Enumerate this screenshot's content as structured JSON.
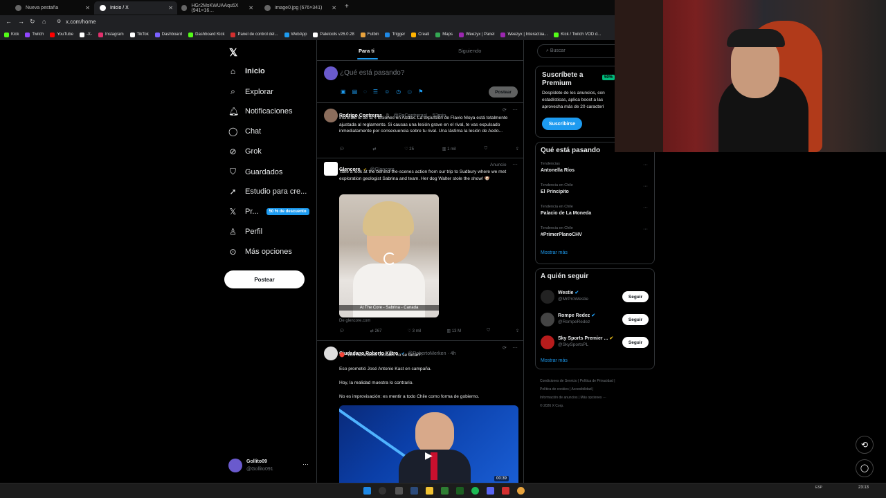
{
  "browser": {
    "tabs": [
      {
        "title": "Nueva pestaña",
        "active": false
      },
      {
        "title": "Inicio / X",
        "active": true
      },
      {
        "title": "HGr2MsKWUAAqu5X (941×16…",
        "active": false
      },
      {
        "title": "image0.jpg (676×341)",
        "active": false
      }
    ],
    "url": "x.com/home",
    "bookmarks": [
      "Kick",
      "Twitch",
      "YouTube",
      "-X-",
      "Instagram",
      "TikTok",
      "Dashboard",
      "Dashboard Kick",
      "Panel de control del...",
      "WebApp",
      "Paletools v26.0.28",
      "Futbin",
      "Trigger",
      "Creati",
      "Maps",
      "Weezyx | Panel",
      "Weezyx | Interactúa...",
      "Kick / Twitch VOD d..."
    ]
  },
  "sidebar": {
    "items": [
      {
        "label": "Inicio",
        "icon": "home-icon"
      },
      {
        "label": "Explorar",
        "icon": "search-icon"
      },
      {
        "label": "Notificaciones",
        "icon": "bell-icon"
      },
      {
        "label": "Chat",
        "icon": "chat-icon"
      },
      {
        "label": "Grok",
        "icon": "grok-icon"
      },
      {
        "label": "Guardados",
        "icon": "bookmark-icon"
      },
      {
        "label": "Estudio para cre...",
        "icon": "rocket-icon"
      },
      {
        "label": "Pr...",
        "icon": "x-logo-icon"
      },
      {
        "label": "Perfil",
        "icon": "person-icon"
      },
      {
        "label": "Más opciones",
        "icon": "more-icon"
      }
    ],
    "promo_badge": "50 % de descuento",
    "post_button": "Postear",
    "account": {
      "name": "Gollito09",
      "handle": "@Gollito091"
    }
  },
  "feed": {
    "tabs": [
      "Para ti",
      "Siguiendo"
    ],
    "composer_placeholder": "¿Qué está pasando?",
    "composer_button": "Postear",
    "tweets": [
      {
        "name": "Rodrigo Contreras",
        "handle": "@RoContrerasL · 53min",
        "text": "Increíble lo de la 4 lesiones en Audax. La expulsión de Flavio Moya está totalmente ajustada al reglamento. Si causas una lesión grave en el rival, te vas expulsado inmediatamente por consecuencia sobre tu rival. Una lástima la lesión de Aedo...",
        "likes": "25",
        "views": "1 mil"
      },
      {
        "name": "Glencore",
        "handle": "@Glencore",
        "ad_label": "Anuncio",
        "text": "Take a look at the behind-the-scenes action from our trip to Sudbury where we met exploration geologist Sabrina and team. Her dog Walter stole the show! 🐶",
        "media_caption": "At The Core - Sabrina - Canada",
        "source": "De glencore.com",
        "retweets": "267",
        "likes": "3 mil",
        "views": "13 M"
      },
      {
        "name": "Ciudadano Roberto Kiltro",
        "handle": "@RobertoMerken · 4h",
        "lines": [
          "🔴 \"Los beneficios sociales no se tocan\".",
          "Eso prometió José Antonio Kast en campaña.",
          "Hoy, la realidad muestra lo contrario.",
          "No es improvisación: es mentir a todo Chile como forma de gobierno."
        ],
        "video_time": "00:39"
      }
    ]
  },
  "right": {
    "search_placeholder": "Buscar",
    "premium": {
      "title": "Suscríbete a Premium",
      "badge": "50%",
      "text": "Despídete de los anuncios, con estadísticas, aplica boost a las aprovecha más de 20 caracterí",
      "button": "Suscribirse"
    },
    "trends_title": "Qué está pasando",
    "trends": [
      {
        "context": "Tendencias",
        "name": "Antonella Ríos"
      },
      {
        "context": "Tendencia en Chile",
        "name": "El Principito"
      },
      {
        "context": "Tendencia en Chile",
        "name": "Palacio de La Moneda"
      },
      {
        "context": "Tendencia en Chile",
        "name": "#PrimerPlanoCHV"
      }
    ],
    "show_more": "Mostrar más",
    "follow_title": "A quién seguir",
    "follow": [
      {
        "name": "Westie",
        "handle": "@MrProWestie",
        "button": "Seguir"
      },
      {
        "name": "Rompe Redez",
        "handle": "@RompeRedez",
        "button": "Seguir"
      },
      {
        "name": "Sky Sports Premier ...",
        "handle": "@SkySportsPL",
        "button": "Seguir"
      }
    ],
    "footer": [
      "Condiciones de Servicio | Política de Privacidad |",
      "Política de cookies | Accesibilidad |",
      "Información de anuncios | Más opciones ···",
      "© 2026 X Corp."
    ]
  },
  "taskbar": {
    "lang": "ESP",
    "time": "23:13"
  },
  "colors": {
    "accent": "#1d9bf0",
    "bg": "#000000",
    "border": "#2f3336"
  }
}
